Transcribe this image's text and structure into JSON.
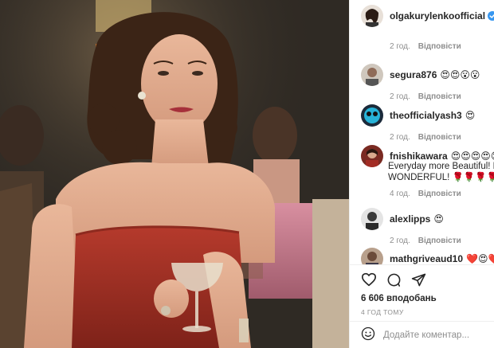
{
  "post": {
    "author": "olgakurylenkoofficial",
    "time_ago": "2 год.",
    "reply_label": "Відповісти"
  },
  "comments": [
    {
      "user": "segura876",
      "text": "😍😍😮😮",
      "time": "2 год.",
      "reply": "Відповісти"
    },
    {
      "user": "theofficialyash3",
      "text": "😍",
      "time": "2 год.",
      "reply": "Відповісти"
    },
    {
      "user": "fnishikawara",
      "text": "😍😍😍😍😍",
      "body_line1": "Everyday more Beautiful! Mo",
      "body_line2": "WONDERFUL! 🌹🌹🌹🌹🌹",
      "time": "4 год.",
      "reply": "Відповісти"
    },
    {
      "user": "alexlipps",
      "text": "😍",
      "time": "2 год.",
      "reply": "Відповісти"
    },
    {
      "user": "mathgriveaud10",
      "text": "❤️😍❤️😍"
    }
  ],
  "actions": {
    "likes": "6 606 вподобань",
    "posted": "4 год тому",
    "comment_placeholder": "Додайте коментар..."
  },
  "colors": {
    "verified": "#3897f0",
    "muted": "#8e8e8e",
    "text": "#262626"
  },
  "icons": [
    "heart-icon",
    "comment-icon",
    "share-icon",
    "verified-badge-icon",
    "emoji-icon"
  ]
}
